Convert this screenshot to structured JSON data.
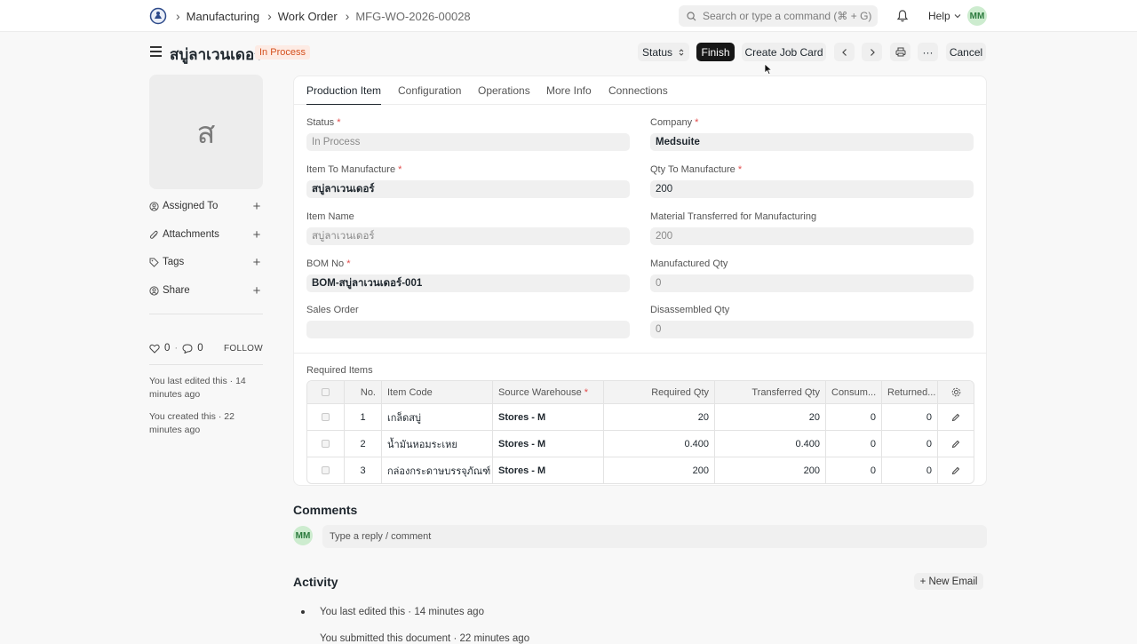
{
  "navbar": {
    "breadcrumbs": [
      "Manufacturing",
      "Work Order",
      "MFG-WO-2026-00028"
    ],
    "search_placeholder": "Search or type a command (⌘ + G)",
    "help_label": "Help",
    "user_initials": "MM"
  },
  "header": {
    "title": "สบู่ลาเวนเดอร์",
    "status_badge": "In Process",
    "status_button": "Status",
    "finish_button": "Finish",
    "job_card_button": "Create Job Card",
    "more_button": "···",
    "cancel_button": "Cancel"
  },
  "sidebar": {
    "image_letter": "ส",
    "items": [
      {
        "label": "Assigned To"
      },
      {
        "label": "Attachments"
      },
      {
        "label": "Tags"
      },
      {
        "label": "Share"
      }
    ],
    "likes_count": "0",
    "comments_count": "0",
    "follow_label": "FOLLOW",
    "last_edited": "You last edited this · 14 minutes ago",
    "created": "You created this · 22 minutes ago"
  },
  "tabs": [
    "Production Item",
    "Configuration",
    "Operations",
    "More Info",
    "Connections"
  ],
  "fields": {
    "status_label": "Status",
    "status_value": "In Process",
    "company_label": "Company",
    "company_value": "Medsuite",
    "item_to_manufacture_label": "Item To Manufacture",
    "item_to_manufacture_value": "สบู่ลาเวนเดอร์",
    "qty_label": "Qty To Manufacture",
    "qty_value": "200",
    "item_name_label": "Item Name",
    "item_name_value": "สบู่ลาเวนเดอร์",
    "material_transferred_label": "Material Transferred for Manufacturing",
    "material_transferred_value": "200",
    "bom_label": "BOM No",
    "bom_value": "BOM-สบู่ลาเวนเดอร์-001",
    "manufactured_qty_label": "Manufactured Qty",
    "manufactured_qty_value": "0",
    "sales_order_label": "Sales Order",
    "sales_order_value": "",
    "disassembled_qty_label": "Disassembled Qty",
    "disassembled_qty_value": "0"
  },
  "required_items": {
    "label": "Required Items",
    "columns": [
      "No.",
      "Item Code",
      "Source Warehouse",
      "Required Qty",
      "Transferred Qty",
      "Consum...",
      "Returned..."
    ],
    "rows": [
      {
        "no": "1",
        "item_code": "เกล็ดสบู่",
        "warehouse": "Stores - M",
        "required": "20",
        "transferred": "20",
        "consumed": "0",
        "returned": "0"
      },
      {
        "no": "2",
        "item_code": "น้ำมันหอมระเหย",
        "warehouse": "Stores - M",
        "required": "0.400",
        "transferred": "0.400",
        "consumed": "0",
        "returned": "0"
      },
      {
        "no": "3",
        "item_code": "กล่องกระดาษบรรจุภัณฑ์",
        "warehouse": "Stores - M",
        "required": "200",
        "transferred": "200",
        "consumed": "0",
        "returned": "0"
      }
    ]
  },
  "comments": {
    "heading": "Comments",
    "placeholder": "Type a reply / comment",
    "user_initials": "MM"
  },
  "activity": {
    "heading": "Activity",
    "new_email": "+ New Email",
    "items": [
      "You last edited this · 14 minutes ago",
      "You submitted this document · 22 minutes ago"
    ]
  }
}
